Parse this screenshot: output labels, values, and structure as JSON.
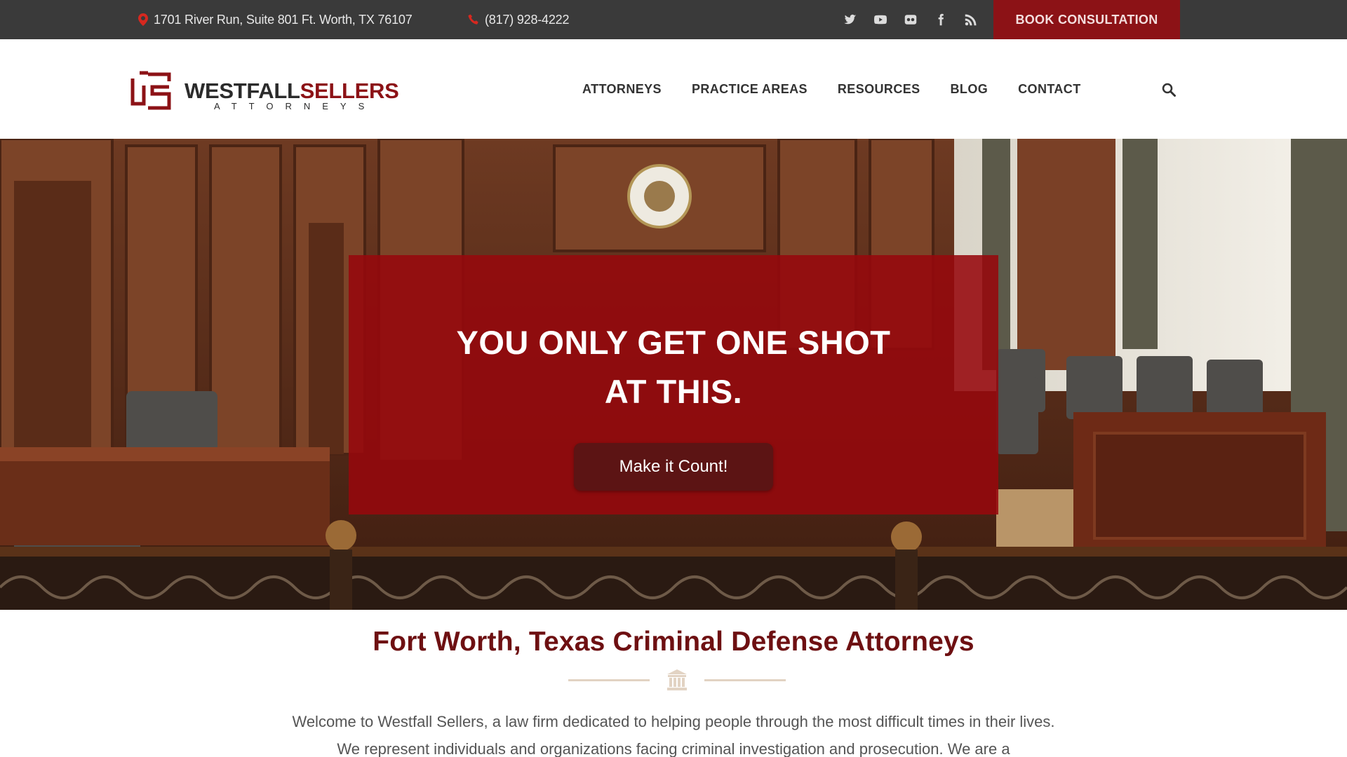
{
  "topbar": {
    "address": "1701 River Run, Suite 801  Ft. Worth, TX 76107",
    "phone": "(817) 928-4222",
    "social_icons": [
      "twitter-icon",
      "youtube-icon",
      "flickr-icon",
      "facebook-icon",
      "rss-icon"
    ],
    "book_label": "BOOK CONSULTATION"
  },
  "header": {
    "logo": {
      "name_part1": "WESTFALL",
      "name_part2": "SELLERS",
      "sub": "ATTORNEYS"
    },
    "nav": [
      "ATTORNEYS",
      "PRACTICE AREAS",
      "RESOURCES",
      "BLOG",
      "CONTACT"
    ],
    "search_icon": "search-icon"
  },
  "hero": {
    "title_line1": "YOU ONLY GET ONE SHOT",
    "title_line2": "AT THIS.",
    "cta_label": "Make it Count!"
  },
  "intro": {
    "title": "Fort Worth, Texas Criminal Defense Attorneys",
    "divider_icon": "column-icon",
    "line1": "Welcome to Westfall Sellers, a law firm dedicated to helping people through the most difficult times in their lives.",
    "line2": "We represent individuals and organizations facing criminal investigation and prosecution. We are a"
  },
  "colors": {
    "brand_red": "#8c1216",
    "topbar_bg": "#3a3a3a",
    "hero_overlay": "#96080c",
    "title_red": "#6e1012"
  }
}
